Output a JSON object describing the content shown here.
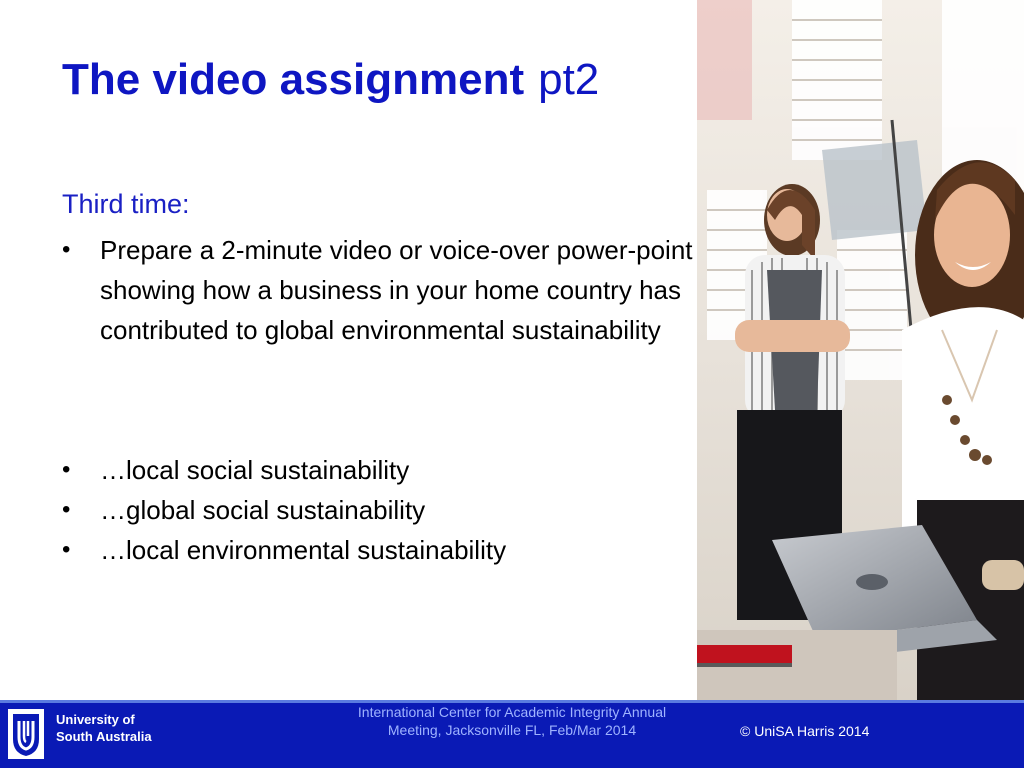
{
  "slide": {
    "title": "The video assignment",
    "title_suffix": "pt2",
    "subhead": "Third time:",
    "bullets_top": [
      "Prepare a 2-minute video or voice-over power-point showing how a business in your home country has contributed to global environmental sustainability"
    ],
    "bullets_bottom": [
      "…local social sustainability",
      "…global social sustainability",
      "…local environmental sustainability"
    ],
    "bullet_glyph": "•"
  },
  "footer": {
    "org_line1": "University of",
    "org_line2": "South Australia",
    "conference": "International Center for Academic Integrity Annual Meeting, Jacksonville FL, Feb/Mar 2014",
    "copyright": "© UniSA Harris 2014"
  },
  "colors": {
    "title": "#0e16c2",
    "footer_bg": "#0a1ab5"
  },
  "icons": {
    "logo": "unisa-logo-icon",
    "photo": "students-with-laptop-photo"
  }
}
